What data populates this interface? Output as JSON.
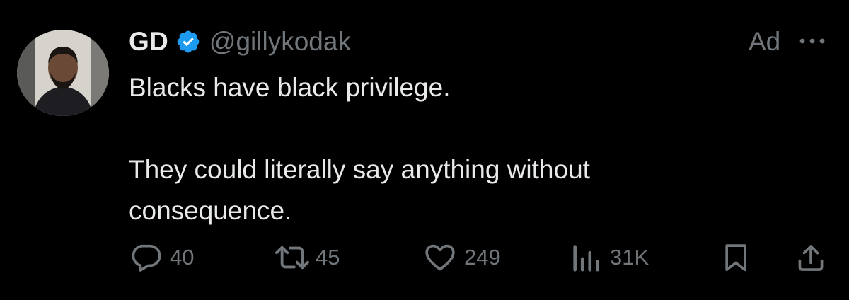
{
  "tweet": {
    "author_name": "GD",
    "handle": "@gillykodak",
    "verified": true,
    "ad_label": "Ad",
    "text_lines": [
      "Blacks have black privilege.",
      "",
      "They could literally say anything without consequence."
    ]
  },
  "actions": {
    "replies": "40",
    "reposts": "45",
    "likes": "249",
    "views": "31K"
  },
  "colors": {
    "background": "#000000",
    "primary_text": "#e7e9ea",
    "secondary_text": "#71767b",
    "verified_badge": "#1d9bf0"
  },
  "icons": {
    "verified": "verified-badge-icon",
    "more": "more-dots-icon",
    "reply": "reply-icon",
    "repost": "repost-icon",
    "like": "heart-icon",
    "views": "views-icon",
    "bookmark": "bookmark-icon",
    "share": "share-icon"
  }
}
